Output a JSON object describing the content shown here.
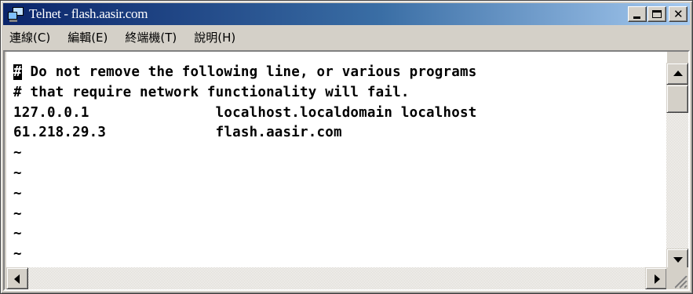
{
  "window": {
    "title": "Telnet - flash.aasir.com",
    "colors": {
      "titlebar_start": "#0a246a",
      "titlebar_end": "#a6caf0",
      "chrome": "#d4d0c8",
      "terminal_bg": "#ffffff",
      "terminal_text": "#000000"
    }
  },
  "menu": {
    "items": [
      {
        "label": "連線(C)"
      },
      {
        "label": "編輯(E)"
      },
      {
        "label": "終端機(T)"
      },
      {
        "label": "說明(H)"
      }
    ]
  },
  "terminal": {
    "cursor_char": "#",
    "first_line_rest": " Do not remove the following line, or various programs",
    "lines": [
      "# that require network functionality will fail.",
      "127.0.0.1               localhost.localdomain localhost",
      "61.218.29.3             flash.aasir.com",
      "~",
      "~",
      "~",
      "~",
      "~",
      "~"
    ]
  },
  "icons": {
    "app": "telnet-computer-icon",
    "minimize": "minimize-icon",
    "maximize": "maximize-icon",
    "close": "close-icon"
  }
}
